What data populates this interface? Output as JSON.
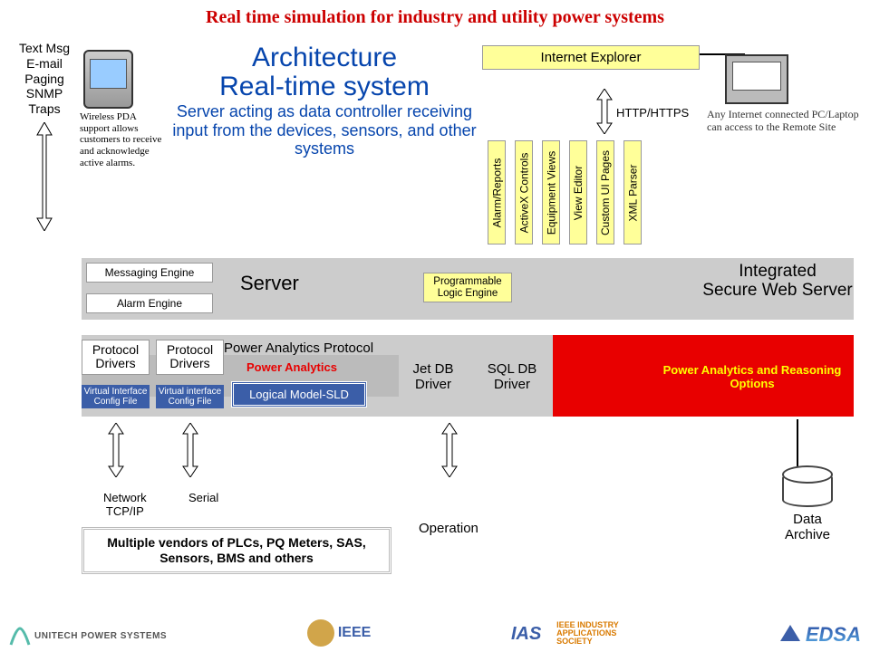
{
  "title": "Real time simulation for industry and utility power systems",
  "notifications": [
    "Text Msg",
    "E-mail",
    "Paging",
    "SNMP Traps"
  ],
  "pda_caption": "Wireless PDA support allows customers to receive and acknowledge active alarms.",
  "architecture": {
    "heading_l1": "Architecture",
    "heading_l2": "Real-time system",
    "sub": "Server acting as data controller receiving input from the devices, sensors, and other systems"
  },
  "browser_box": "Internet Explorer",
  "http_label": "HTTP/HTTPS",
  "vertical_labels": [
    "Alarm/Reports",
    "ActiveX Controls",
    "Equipment Views",
    "View Editor",
    "Custom UI Pages",
    "XML Parser"
  ],
  "pc_caption": "Any Internet connected PC/Laptop can access to the Remote Site",
  "middle": {
    "messaging": "Messaging Engine",
    "alarm": "Alarm Engine",
    "server": "Server",
    "programmable": "Programmable Logic Engine",
    "integrated_l1": "Integrated",
    "integrated_l2": "Secure Web Server"
  },
  "drivers": {
    "protocol": "Protocol Drivers",
    "config": "Virtual Interface Config File",
    "config2": "Virtual interface Config File",
    "pap": "Power Analytics Protocol",
    "pa": "Power Analytics",
    "logical": "Logical Model-SLD",
    "jet": "Jet DB Driver",
    "sql": "SQL DB Driver",
    "reasoning": "Power Analytics and Reasoning Options"
  },
  "bottom": {
    "net1": "Network\nTCP/IP",
    "net2": "Serial",
    "plc": "Multiple vendors of PLCs, PQ Meters, SAS, Sensors, BMS and others",
    "operation": "Operation",
    "archive": "Data Archive"
  },
  "sponsors": {
    "unitech": "UNITECH POWER SYSTEMS",
    "ieee": "IEEE",
    "ias": "IEEE INDUSTRY APPLICATIONS SOCIETY",
    "edsa": "EDSA"
  }
}
